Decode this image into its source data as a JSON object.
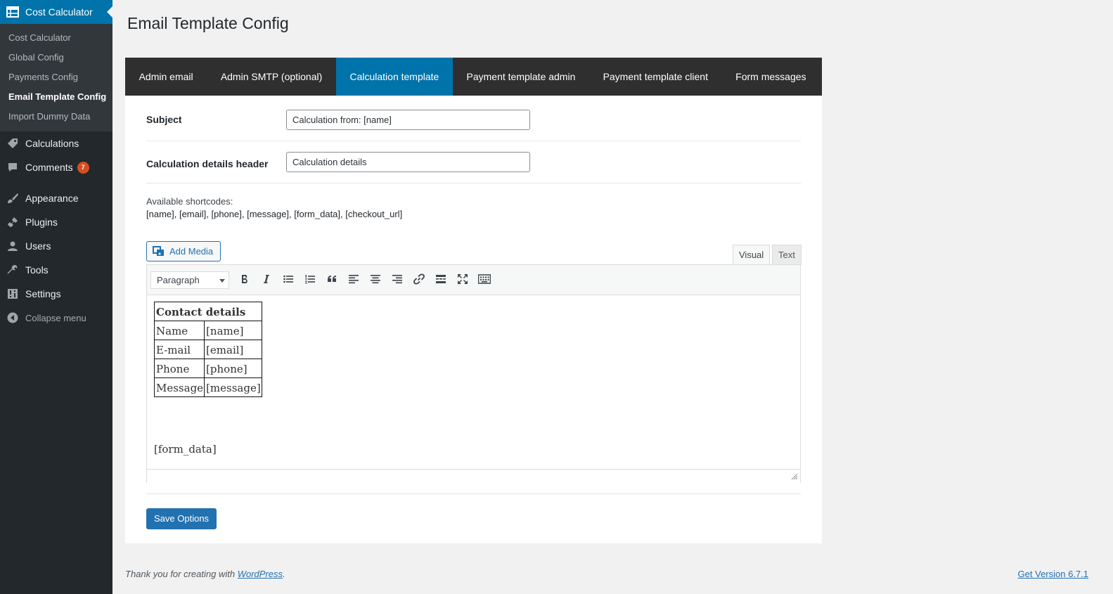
{
  "sidebar": {
    "header_label": "Cost Calculator",
    "submenu": [
      {
        "label": "Cost Calculator"
      },
      {
        "label": "Global Config"
      },
      {
        "label": "Payments Config"
      },
      {
        "label": "Email Template Config"
      },
      {
        "label": "Import Dummy Data"
      }
    ],
    "calculations": "Calculations",
    "comments": "Comments",
    "comments_count": "7",
    "appearance": "Appearance",
    "plugins": "Plugins",
    "users": "Users",
    "tools": "Tools",
    "settings": "Settings",
    "collapse": "Collapse menu",
    "colors": {
      "bg": "#23282d",
      "accent": "#0073aa",
      "badge": "#d54e21"
    }
  },
  "page": {
    "title": "Email Template Config"
  },
  "tabs": [
    {
      "label": "Admin email"
    },
    {
      "label": "Admin SMTP (optional)"
    },
    {
      "label": "Calculation template",
      "active": true
    },
    {
      "label": "Payment template admin"
    },
    {
      "label": "Payment template client"
    },
    {
      "label": "Form messages"
    }
  ],
  "form": {
    "subject_label": "Subject",
    "subject_value": "Calculation from: [name]",
    "details_header_label": "Calculation details header",
    "details_header_value": "Calculation details",
    "shortcodes_label": "Available shortcodes:",
    "shortcodes_list": "[name], [email], [phone], [message], [form_data], [checkout_url]"
  },
  "editor": {
    "add_media": "Add Media",
    "tab_visual": "Visual",
    "tab_text": "Text",
    "format": "Paragraph",
    "toolbar_icons": [
      "bold-icon",
      "italic-icon",
      "bullet-list-icon",
      "numbered-list-icon",
      "blockquote-icon",
      "align-left-icon",
      "align-center-icon",
      "align-right-icon",
      "link-icon",
      "read-more-icon",
      "fullscreen-icon",
      "toolbar-toggle-icon"
    ],
    "table": {
      "header": "Contact details",
      "rows": [
        {
          "label": "Name",
          "value": "[name]"
        },
        {
          "label": "E-mail",
          "value": "[email]"
        },
        {
          "label": "Phone",
          "value": "[phone]"
        },
        {
          "label": "Message",
          "value": "[message]"
        }
      ]
    },
    "form_data": "[form_data]"
  },
  "save_label": "Save Options",
  "footer": {
    "thanks_prefix": "Thank you for creating with ",
    "wordpress_link": "WordPress",
    "thanks_suffix": ".",
    "version": "Get Version 6.7.1"
  }
}
